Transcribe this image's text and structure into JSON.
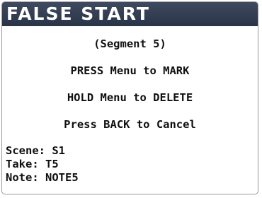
{
  "header": {
    "title": "FALSE START"
  },
  "body": {
    "segment": "(Segment 5)",
    "instructions": [
      "PRESS Menu to MARK",
      "HOLD Menu to DELETE",
      "Press BACK to Cancel"
    ]
  },
  "meta": {
    "scene": "Scene: S1",
    "take": "Take: T5",
    "note": "Note: NOTE5"
  }
}
